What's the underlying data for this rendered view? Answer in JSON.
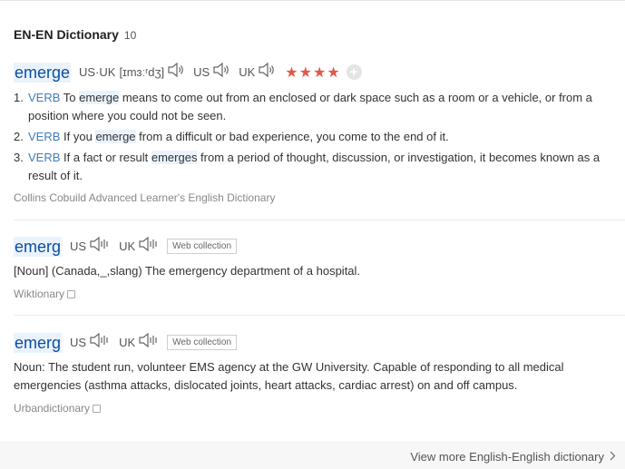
{
  "header": {
    "title": "EN-EN Dictionary",
    "count": "10"
  },
  "entry1": {
    "word": "emerge",
    "us_uk_label": "US·UK",
    "phonetic": "[ɪmɜːʳdʒ]",
    "us_label": "US",
    "uk_label": "UK",
    "rating": "★★★★",
    "rating_value": 4,
    "definitions": [
      {
        "num": "1.",
        "pos": "VERB",
        "pre": "To ",
        "hl": "emerge",
        "post": " means to come out from an enclosed or dark space such as a room or a vehicle, or from a position where you could not be seen."
      },
      {
        "num": "2.",
        "pos": "VERB",
        "pre": "If you ",
        "hl": "emerge",
        "post": " from a difficult or bad experience, you come to the end of it."
      },
      {
        "num": "3.",
        "pos": "VERB",
        "pre": "If a fact or result ",
        "hl": "emerges",
        "post": " from a period of thought, discussion, or investigation, it becomes known as a result of it."
      }
    ],
    "source": "Collins Cobuild Advanced Learner's English Dictionary"
  },
  "entry2": {
    "word": "emerg",
    "us_label": "US",
    "uk_label": "UK",
    "tag": "Web collection",
    "text": "[Noun] (Canada,_,slang) The emergency department of a hospital.",
    "source": "Wiktionary"
  },
  "entry3": {
    "word": "emerg",
    "us_label": "US",
    "uk_label": "UK",
    "tag": "Web collection",
    "text": "Noun: The student run, volunteer EMS agency at the GW University. Capable of responding to all medical emergencies (asthma attacks, dislocated joints, heart attacks, cardiac arrest) on and off campus.",
    "source": "Urbandictionary"
  },
  "footer": {
    "more_label": "View more English-English dictionary"
  },
  "colors": {
    "accent": "#0c4e9e",
    "pos": "#3f7bbf",
    "star": "#e05a4a",
    "highlight": "#eaf3fc"
  },
  "icons": {
    "speaker": "speaker-icon",
    "plus": "plus-icon",
    "copy": "copy-icon",
    "chevron": "chevron-right-icon"
  }
}
